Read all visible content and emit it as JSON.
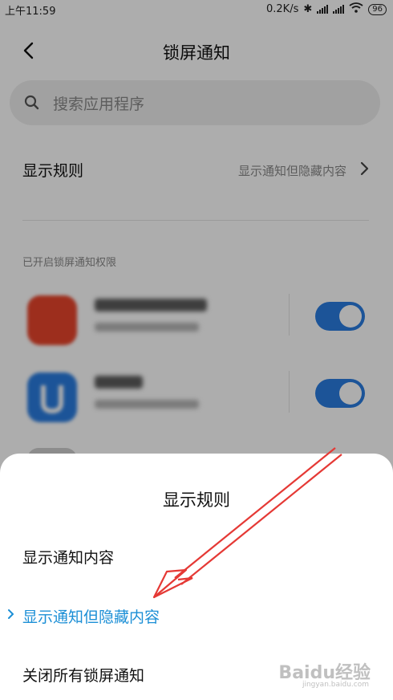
{
  "status": {
    "time": "上午11:59",
    "speed": "0.2K/s",
    "battery": "96"
  },
  "header": {
    "title": "锁屏通知"
  },
  "search": {
    "placeholder": "搜索应用程序"
  },
  "rule": {
    "label": "显示规则",
    "value": "显示通知但隐藏内容"
  },
  "section": {
    "label": "已开启锁屏通知权限"
  },
  "apps": [
    {
      "icon_color": "#e8452c",
      "enabled": true
    },
    {
      "icon_color": "#2a7de1",
      "enabled": true
    }
  ],
  "sheet": {
    "title": "显示规则",
    "options": [
      {
        "label": "显示通知内容",
        "selected": false
      },
      {
        "label": "显示通知但隐藏内容",
        "selected": true
      },
      {
        "label": "关闭所有锁屏通知",
        "selected": false
      }
    ]
  },
  "watermark": {
    "text": "Baidu经验",
    "sub": "jingyan.baidu.com"
  },
  "colors": {
    "accent": "#1c8fd6",
    "toggle": "#2a7de1",
    "annotation": "#e53935"
  }
}
